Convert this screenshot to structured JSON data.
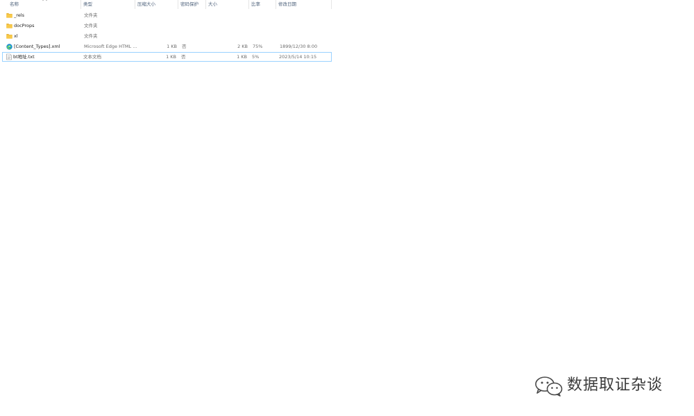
{
  "columns": {
    "name": "名称",
    "type": "类型",
    "packed_size": "压缩大小",
    "password_protected": "密码保护",
    "size": "大小",
    "ratio": "比率",
    "modified": "修改日期"
  },
  "rows": [
    {
      "name": "_rels",
      "icon": "folder-icon",
      "type": "文件夹",
      "packed_size": "",
      "password_protected": "",
      "size": "",
      "ratio": "",
      "modified": ""
    },
    {
      "name": "docProps",
      "icon": "folder-icon",
      "type": "文件夹",
      "packed_size": "",
      "password_protected": "",
      "size": "",
      "ratio": "",
      "modified": ""
    },
    {
      "name": "xl",
      "icon": "folder-icon",
      "type": "文件夹",
      "packed_size": "",
      "password_protected": "",
      "size": "",
      "ratio": "",
      "modified": ""
    },
    {
      "name": "[Content_Types].xml",
      "icon": "edge-icon",
      "type": "Microsoft Edge HTML ...",
      "packed_size": "1 KB",
      "password_protected": "否",
      "size": "2 KB",
      "ratio": "75%",
      "modified": "1899/12/30 8:00"
    },
    {
      "name": "bt地址.txt",
      "icon": "text-file-icon",
      "type": "文本文档",
      "packed_size": "1 KB",
      "password_protected": "否",
      "size": "1 KB",
      "ratio": "5%",
      "modified": "2023/5/14 10:15"
    }
  ],
  "watermark": {
    "text": "数据取证杂谈",
    "icon": "wechat-icon"
  },
  "colors": {
    "folder": "#f8c94a",
    "selection_border": "#99d1ff",
    "header_text": "#4c607a",
    "cell_text": "#6d6d6d"
  }
}
